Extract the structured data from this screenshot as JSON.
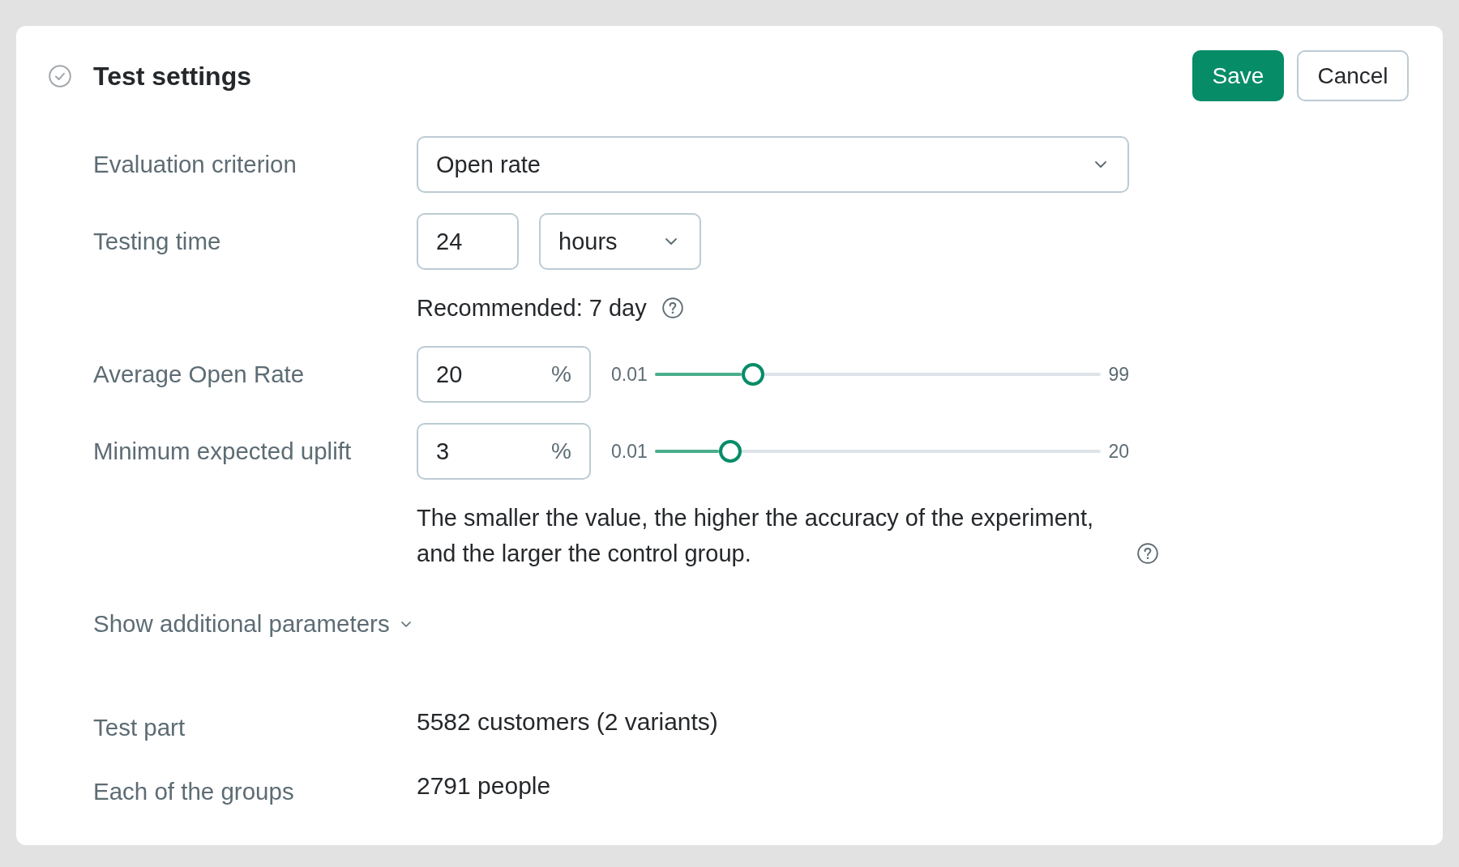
{
  "header": {
    "title": "Test settings"
  },
  "buttons": [
    {
      "label": "Save",
      "kind": "primary"
    },
    {
      "label": "Cancel",
      "kind": "secondary"
    }
  ],
  "fields": [
    {
      "kind": "select",
      "label": "Evaluation criterion",
      "value": "Open rate"
    },
    {
      "kind": "duration",
      "label": "Testing time",
      "value": "24",
      "unit": "hours",
      "hint": "Recommended: 7 day"
    },
    {
      "kind": "percent_slider",
      "label": "Average Open Rate",
      "value": "20",
      "suffix": "%",
      "min": "0.01",
      "max": "99",
      "level": 0.22
    },
    {
      "kind": "percent_slider",
      "label": "Minimum expected uplift",
      "value": "3",
      "suffix": "%",
      "min": "0.01",
      "max": "20",
      "level": 0.17,
      "hint": "The smaller the value, the higher the accuracy of the experiment, and the larger the control group."
    }
  ],
  "toggle": {
    "label": "Show additional parameters",
    "expanded": false
  },
  "summary": [
    {
      "label": "Test part",
      "value": "5582 customers (2 variants)"
    },
    {
      "label": "Each of the groups",
      "value": "2791 people"
    }
  ]
}
